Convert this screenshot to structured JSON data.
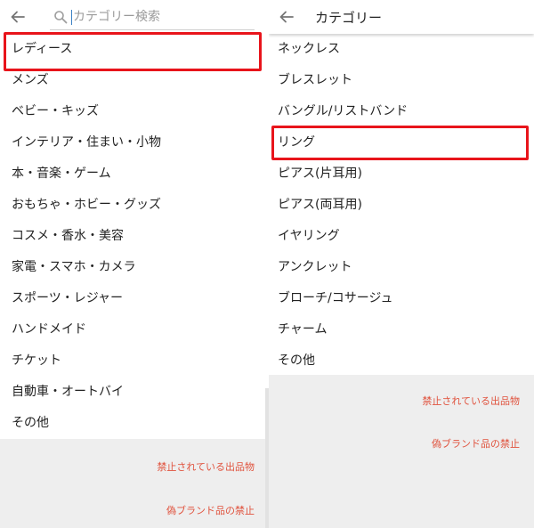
{
  "left": {
    "search": {
      "placeholder": "カテゴリー検索",
      "value": ""
    },
    "items": [
      "レディース",
      "メンズ",
      "ベビー・キッズ",
      "インテリア・住まい・小物",
      "本・音楽・ゲーム",
      "おもちゃ・ホビー・グッズ",
      "コスメ・香水・美容",
      "家電・スマホ・カメラ",
      "スポーツ・レジャー",
      "ハンドメイド",
      "チケット",
      "自動車・オートバイ",
      "その他"
    ],
    "footer": {
      "prohibited": "禁止されている出品物",
      "counterfeit": "偽ブランド品の禁止"
    }
  },
  "right": {
    "title": "カテゴリー",
    "items": [
      "ネックレス",
      "ブレスレット",
      "バングル/リストバンド",
      "リング",
      "ピアス(片耳用)",
      "ピアス(両耳用)",
      "イヤリング",
      "アンクレット",
      "ブローチ/コサージュ",
      "チャーム",
      "その他"
    ],
    "footer": {
      "prohibited": "禁止されている出品物",
      "counterfeit": "偽ブランド品の禁止"
    }
  },
  "colors": {
    "highlight": "#e8141b",
    "footer_link": "#e0533e",
    "footer_bg": "#eeeeee"
  }
}
